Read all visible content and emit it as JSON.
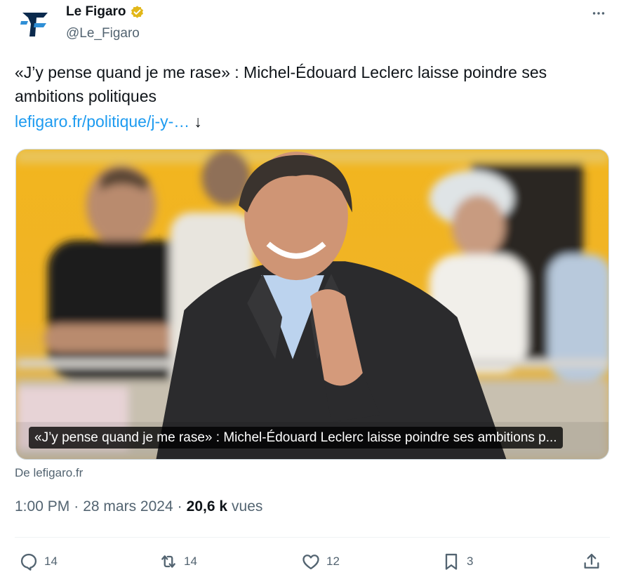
{
  "account": {
    "display_name": "Le Figaro",
    "handle": "@Le_Figaro",
    "verified_badge_color": "#e2b719",
    "avatar_icon": "le-figaro-logo-icon",
    "avatar_colors": {
      "dark": "#0b2a4d",
      "light": "#2f8fd6"
    }
  },
  "tweet": {
    "text": "«J’y pense quand je me rase» : Michel-Édouard Leclerc laisse poindre ses ambitions politiques",
    "link_text": "lefigaro.fr/politique/j-y-…",
    "link_arrow": "↓"
  },
  "card": {
    "image_icon": "photo-man-clasping-hands",
    "caption": "«J’y pense quand je me rase» : Michel-Édouard Leclerc laisse poindre ses ambitions p...",
    "source_label": "De lefigaro.fr"
  },
  "meta": {
    "time": "1:00 PM",
    "separator": "·",
    "date": "28 mars 2024",
    "views_count": "20,6 k",
    "views_label": "vues"
  },
  "actions": {
    "replies": "14",
    "reposts": "14",
    "likes": "12",
    "bookmarks": "3"
  },
  "colors": {
    "text_primary": "#0f1419",
    "text_secondary": "#536471",
    "link": "#1d9bf0"
  }
}
